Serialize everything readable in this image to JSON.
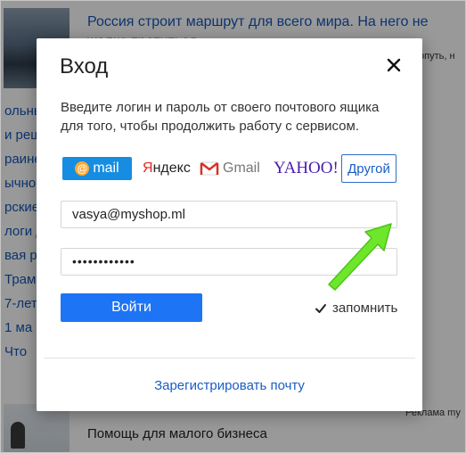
{
  "background": {
    "headline": "Россия строит маршрут для всего мира. На него не жалко тратиться",
    "side_text_right": "корпуть, н",
    "left_words": [
      "ольны",
      "и реш",
      "раине",
      "ычно",
      "рские",
      "логи д",
      "вая ра",
      "Трамп",
      "7-лет",
      "1 ма",
      "Что"
    ],
    "ad_label": "Реклама my",
    "help_link": "Помощь для малого бизнеса"
  },
  "modal": {
    "title": "Вход",
    "close_icon": "close-icon",
    "description": "Введите логин и пароль от своего почтового ящика для того, чтобы продолжить работу с сервисом.",
    "providers": {
      "mail": "mail",
      "yandex_first": "Я",
      "yandex_rest": "ндекс",
      "gmail": "Gmail",
      "yahoo": "YAHOO!",
      "other": "Другой"
    },
    "email_value": "vasya@myshop.ml",
    "password_value": "••••••••••••",
    "login_button": "Войти",
    "remember_label": "запомнить",
    "remember_checked": true,
    "register_link": "Зарегистрировать почту"
  },
  "colors": {
    "accent": "#1d74f5",
    "mail_brand": "#168de2",
    "arrow": "#6ee62a"
  }
}
